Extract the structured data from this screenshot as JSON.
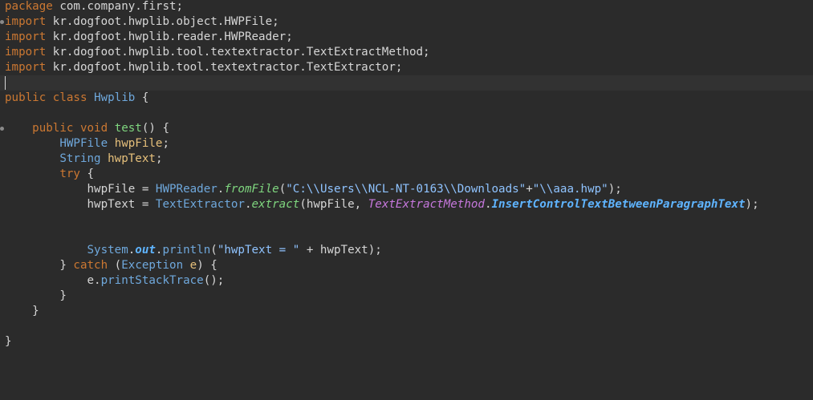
{
  "editor": {
    "lines": [
      {
        "fold": false,
        "current": false,
        "caret": false,
        "tokens": [
          {
            "t": "package",
            "c": "kw"
          },
          {
            "t": " com.company.first;",
            "c": "plain"
          }
        ]
      },
      {
        "fold": true,
        "current": false,
        "caret": false,
        "tokens": [
          {
            "t": "import",
            "c": "kw"
          },
          {
            "t": " kr.dogfoot.hwplib.object.HWPFile;",
            "c": "plain"
          }
        ]
      },
      {
        "fold": false,
        "current": false,
        "caret": false,
        "tokens": [
          {
            "t": "import",
            "c": "kw"
          },
          {
            "t": " kr.dogfoot.hwplib.reader.HWPReader;",
            "c": "plain"
          }
        ]
      },
      {
        "fold": false,
        "current": false,
        "caret": false,
        "tokens": [
          {
            "t": "import",
            "c": "kw"
          },
          {
            "t": " kr.dogfoot.hwplib.tool.textextractor.TextExtractMethod;",
            "c": "plain"
          }
        ]
      },
      {
        "fold": false,
        "current": false,
        "caret": false,
        "tokens": [
          {
            "t": "import",
            "c": "kw"
          },
          {
            "t": " kr.dogfoot.hwplib.tool.textextractor.TextExtractor;",
            "c": "plain"
          }
        ]
      },
      {
        "fold": false,
        "current": true,
        "caret": true,
        "tokens": []
      },
      {
        "fold": false,
        "current": false,
        "caret": false,
        "tokens": [
          {
            "t": "public",
            "c": "kw"
          },
          {
            "t": " ",
            "c": "plain"
          },
          {
            "t": "class",
            "c": "kw"
          },
          {
            "t": " ",
            "c": "plain"
          },
          {
            "t": "Hwplib",
            "c": "cls"
          },
          {
            "t": " {",
            "c": "plain"
          }
        ]
      },
      {
        "fold": false,
        "current": false,
        "caret": false,
        "tokens": []
      },
      {
        "fold": true,
        "current": false,
        "caret": false,
        "tokens": [
          {
            "t": "    ",
            "c": "plain"
          },
          {
            "t": "public",
            "c": "kw"
          },
          {
            "t": " ",
            "c": "plain"
          },
          {
            "t": "void",
            "c": "kw"
          },
          {
            "t": " ",
            "c": "plain"
          },
          {
            "t": "test",
            "c": "fn"
          },
          {
            "t": "() {",
            "c": "plain"
          }
        ]
      },
      {
        "fold": false,
        "current": false,
        "caret": false,
        "tokens": [
          {
            "t": "        ",
            "c": "plain"
          },
          {
            "t": "HWPFile",
            "c": "cls"
          },
          {
            "t": " ",
            "c": "plain"
          },
          {
            "t": "hwpFile",
            "c": "var"
          },
          {
            "t": ";",
            "c": "plain"
          }
        ]
      },
      {
        "fold": false,
        "current": false,
        "caret": false,
        "tokens": [
          {
            "t": "        ",
            "c": "plain"
          },
          {
            "t": "String",
            "c": "cls"
          },
          {
            "t": " ",
            "c": "plain"
          },
          {
            "t": "hwpText",
            "c": "var"
          },
          {
            "t": ";",
            "c": "plain"
          }
        ]
      },
      {
        "fold": false,
        "current": false,
        "caret": false,
        "tokens": [
          {
            "t": "        ",
            "c": "plain"
          },
          {
            "t": "try",
            "c": "kw"
          },
          {
            "t": " {",
            "c": "plain"
          }
        ]
      },
      {
        "fold": false,
        "current": false,
        "caret": false,
        "tokens": [
          {
            "t": "            hwpFile = ",
            "c": "plain"
          },
          {
            "t": "HWPReader",
            "c": "cls"
          },
          {
            "t": ".",
            "c": "plain"
          },
          {
            "t": "fromFile",
            "c": "fn-i"
          },
          {
            "t": "(",
            "c": "plain"
          },
          {
            "t": "\"C:\\\\Users\\\\NCL-NT-0163\\\\Downloads\"",
            "c": "str"
          },
          {
            "t": "+",
            "c": "plain"
          },
          {
            "t": "\"\\\\aaa.hwp\"",
            "c": "str"
          },
          {
            "t": ");",
            "c": "plain"
          }
        ]
      },
      {
        "fold": false,
        "current": false,
        "caret": false,
        "tokens": [
          {
            "t": "            hwpText = ",
            "c": "plain"
          },
          {
            "t": "TextExtractor",
            "c": "cls"
          },
          {
            "t": ".",
            "c": "plain"
          },
          {
            "t": "extract",
            "c": "fn-i"
          },
          {
            "t": "(hwpFile, ",
            "c": "plain"
          },
          {
            "t": "TextExtractMethod",
            "c": "enum-type"
          },
          {
            "t": ".",
            "c": "plain"
          },
          {
            "t": "InsertControlTextBetweenParagraphText",
            "c": "enum-const"
          },
          {
            "t": ");",
            "c": "plain"
          }
        ]
      },
      {
        "fold": false,
        "current": false,
        "caret": false,
        "tokens": []
      },
      {
        "fold": false,
        "current": false,
        "caret": false,
        "tokens": []
      },
      {
        "fold": false,
        "current": false,
        "caret": false,
        "tokens": [
          {
            "t": "            ",
            "c": "plain"
          },
          {
            "t": "System",
            "c": "cls"
          },
          {
            "t": ".",
            "c": "plain"
          },
          {
            "t": "out",
            "c": "field-static"
          },
          {
            "t": ".",
            "c": "plain"
          },
          {
            "t": "println",
            "c": "cls"
          },
          {
            "t": "(",
            "c": "plain"
          },
          {
            "t": "\"hwpText = \"",
            "c": "str"
          },
          {
            "t": " + hwpText);",
            "c": "plain"
          }
        ]
      },
      {
        "fold": false,
        "current": false,
        "caret": false,
        "tokens": [
          {
            "t": "        } ",
            "c": "plain"
          },
          {
            "t": "catch",
            "c": "kw"
          },
          {
            "t": " (",
            "c": "plain"
          },
          {
            "t": "Exception",
            "c": "cls"
          },
          {
            "t": " ",
            "c": "plain"
          },
          {
            "t": "e",
            "c": "var"
          },
          {
            "t": ") {",
            "c": "plain"
          }
        ]
      },
      {
        "fold": false,
        "current": false,
        "caret": false,
        "tokens": [
          {
            "t": "            e.",
            "c": "plain"
          },
          {
            "t": "printStackTrace",
            "c": "cls"
          },
          {
            "t": "();",
            "c": "plain"
          }
        ]
      },
      {
        "fold": false,
        "current": false,
        "caret": false,
        "tokens": [
          {
            "t": "        }",
            "c": "plain"
          }
        ]
      },
      {
        "fold": false,
        "current": false,
        "caret": false,
        "tokens": [
          {
            "t": "    }",
            "c": "plain"
          }
        ]
      },
      {
        "fold": false,
        "current": false,
        "caret": false,
        "tokens": []
      },
      {
        "fold": false,
        "current": false,
        "caret": false,
        "tokens": [
          {
            "t": "}",
            "c": "plain"
          }
        ]
      }
    ]
  },
  "colors": {
    "background": "#2b2b2b",
    "current_line": "#323232",
    "keyword": "#cc7832",
    "type": "#6fa8dc",
    "variable": "#e6c07b",
    "method": "#7fd67f",
    "string": "#8fc3ff",
    "enum_type": "#c678dd",
    "enum_constant": "#5fb4ff"
  }
}
